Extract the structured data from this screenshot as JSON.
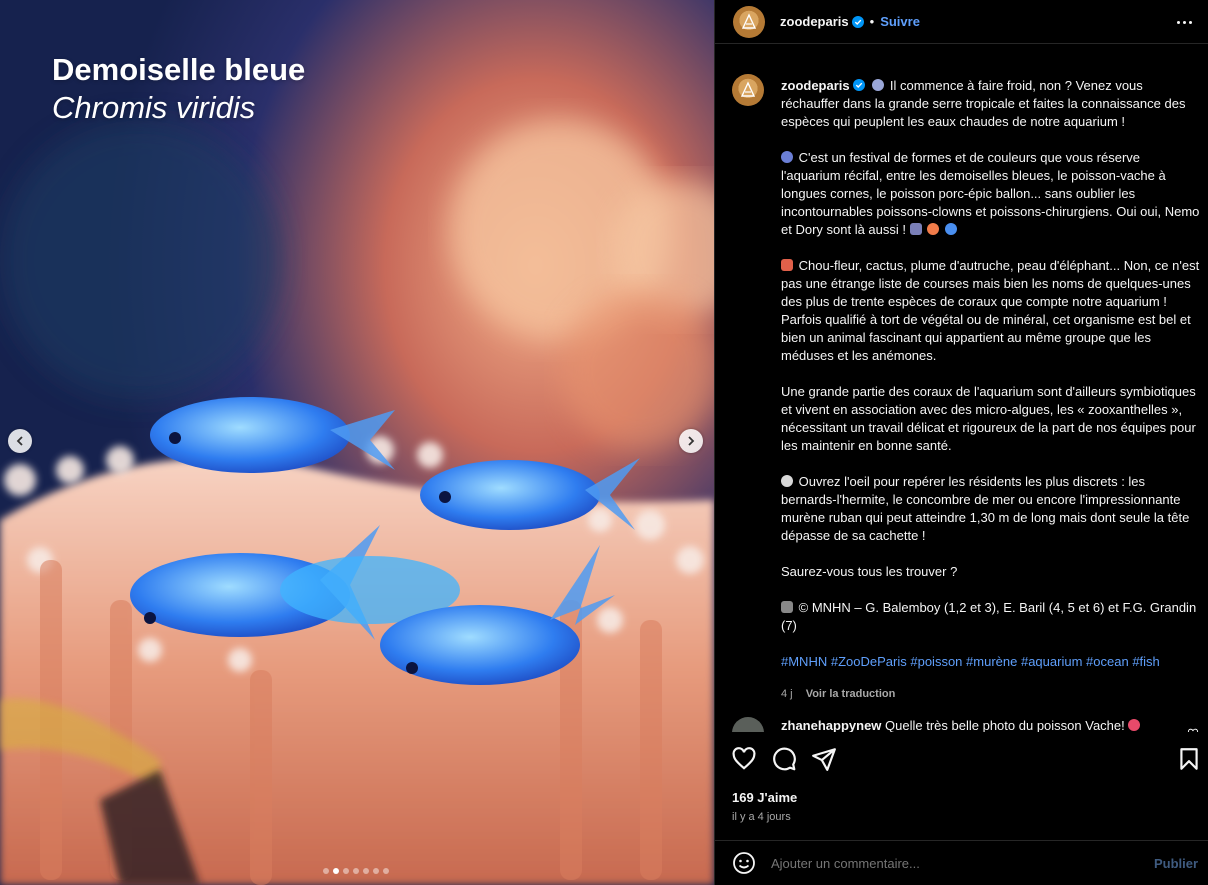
{
  "media": {
    "title": "Demoiselle bleue",
    "subtitle": "Chromis viridis",
    "dots_total": 7,
    "dots_active_index": 1
  },
  "header": {
    "username": "zoodeparis",
    "separator": "•",
    "follow_label": "Suivre"
  },
  "caption": {
    "username": "zoodeparis",
    "paragraphs": [
      "Il commence à faire froid, non ? Venez vous réchauffer dans la grande serre tropicale et faites la connaissance des espèces qui peuplent les eaux chaudes de notre aquarium !",
      "C'est un festival de formes et de couleurs que vous réserve l'aquarium récifal, entre les demoiselles bleues, le poisson-vache à longues cornes, le poisson porc-épic ballon... sans oublier les incontournables poissons-clowns et poissons-chirurgiens. Oui oui, Nemo et Dory sont là aussi !",
      "Chou-fleur, cactus, plume d'autruche, peau d'éléphant... Non, ce n'est pas une étrange liste de courses mais bien les noms de quelques-unes des plus de trente espèces de coraux que compte notre aquarium ! Parfois qualifié à tort de végétal ou de minéral, cet organisme est bel et bien un animal fascinant qui appartient au même groupe que les méduses et les anémones.",
      "Une grande partie des coraux de l'aquarium sont d'ailleurs symbiotiques et vivent en association avec des micro-algues, les « zooxanthelles », nécessitant un travail délicat et rigoureux de la part de nos équipes pour les maintenir en bonne santé.",
      "Ouvrez l'oeil pour repérer les résidents les plus discrets : les bernards-l'hermite, le concombre de mer ou encore l'impressionnante murène ruban qui peut atteindre 1,30 m de long mais dont seule la tête dépasse de sa cachette !",
      "Saurez-vous tous les trouver ?",
      "© MNHN – G. Balemboy (1,2 et 3), E. Baril (4, 5 et 6) et F.G. Grandin (7)"
    ],
    "hashtags": [
      "#MNHN",
      "#ZooDeParis",
      "#poisson",
      "#murène",
      "#aquarium",
      "#ocean",
      "#fish"
    ],
    "age": "4 j",
    "translate_label": "Voir la traduction"
  },
  "comment": {
    "username": "zhanehappynew",
    "text": "Quelle très belle photo du poisson Vache!"
  },
  "likes_text": "169 J'aime",
  "time_ago": "il y a 4 jours",
  "comment_box": {
    "placeholder": "Ajouter un commentaire...",
    "publish_label": "Publier"
  },
  "icons": {
    "like": "heart-icon",
    "comment": "comment-icon",
    "share": "send-icon",
    "save": "bookmark-icon",
    "emoji": "smiley-icon"
  },
  "colors": {
    "link_blue": "#5f9ffb",
    "muted": "#a8a8a8",
    "background": "#000000"
  }
}
